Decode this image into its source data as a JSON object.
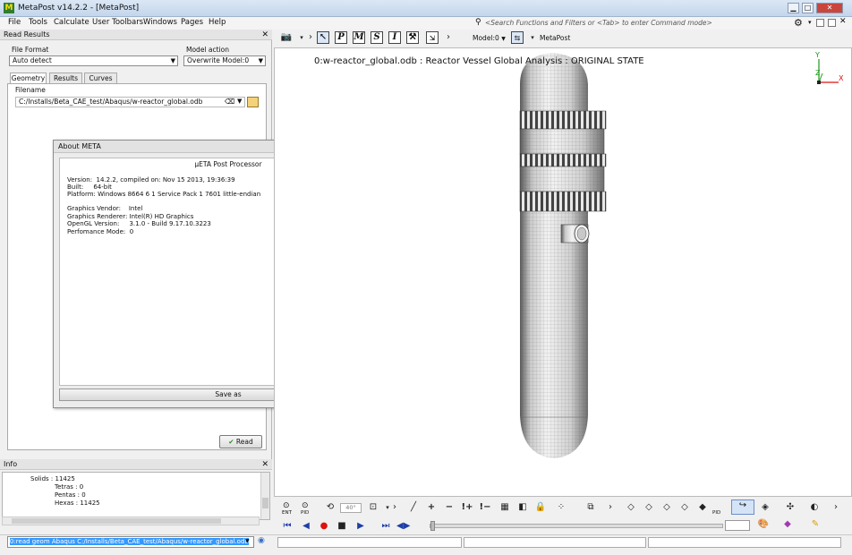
{
  "window": {
    "title": "MetaPost v14.2.2 - [MetaPost]",
    "app_icon": "M"
  },
  "menu": [
    "File",
    "Tools",
    "Calculate",
    "User Toolbars",
    "Windows",
    "Pages",
    "Help"
  ],
  "command_search": {
    "placeholder": "<Search Functions and Filters or <Tab> to enter Command mode>"
  },
  "read_results": {
    "header": "Read Results",
    "file_format_label": "File Format",
    "file_format_value": "Auto detect",
    "model_action_label": "Model action",
    "model_action_value": "Overwrite Model:0",
    "tabs": [
      "Geometry",
      "Results",
      "Curves"
    ],
    "filename_label": "Filename",
    "filename_value": "C:/Installs/Beta_CAE_test/Abaqus/w-reactor_global.odb",
    "read_button": "Read"
  },
  "info": {
    "header": "Info",
    "lines": [
      "Solids : 11425",
      "Tetras : 0",
      "Pentas : 0",
      "Hexas : 11425"
    ]
  },
  "about": {
    "title": "About META",
    "product": "μETA Post Processor",
    "lines": [
      "Version:  14.2.2, compiled on: Nov 15 2013, 19:36:39",
      "Built:     64-bit",
      "Platform: Windows 8664 6 1 Service Pack 1 7601 little-endian",
      "",
      "Graphics Vendor:    Intel",
      "Graphics Renderer: Intel(R) HD Graphics",
      "OpenGL Version:     3.1.0 - Build 9.17.10.3223",
      "Perfomance Mode:  0"
    ],
    "save_button": "Save as"
  },
  "viewer": {
    "toolbar_model": "Model:0",
    "toolbar_window": "MetaPost",
    "title_text": "0:w-reactor_global.odb  : Reactor Vessel Global Analysis  : ORIGINAL STATE",
    "angle_value": "40°",
    "axis_labels": [
      "Y",
      "Z",
      "X"
    ]
  },
  "command_line": {
    "value": "0:read geom Abaqus C:/Installs/Beta_CAE_test/Abaqus/w-reactor_global.odb"
  },
  "toolbar_labels": {
    "ent": "ENT",
    "pid": "PID",
    "pid2": "PID"
  },
  "colors": {
    "accent": "#3399ff",
    "axis_x": "#d11",
    "axis_y": "#1a9a1a",
    "axis_z": "#1a9a1a"
  }
}
